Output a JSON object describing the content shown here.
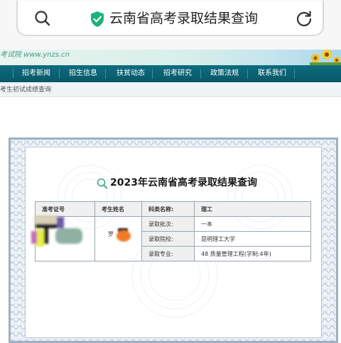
{
  "browser": {
    "url_title": "云南省高考录取结果查询",
    "icons": {
      "search": "search-icon",
      "secure": "shield-check-icon",
      "reload": "reload-icon"
    }
  },
  "site": {
    "banner_text": "考试院 www.ynzs.cn",
    "nav": [
      {
        "label": "招考新闻"
      },
      {
        "label": "招生信息"
      },
      {
        "label": "扶贫动态"
      },
      {
        "label": "招考研究"
      },
      {
        "label": "政策法规"
      },
      {
        "label": "联系我们"
      }
    ],
    "sub_link": "考生初试成绩查询"
  },
  "result": {
    "title": "2023年云南省高考录取结果查询",
    "headers": {
      "exam_no": "准考证号",
      "name": "考生姓名",
      "subject_type": "科类名称:",
      "subject_value": "理工"
    },
    "name_prefix": "罗",
    "rows": [
      {
        "label": "录取批次:",
        "value": "一本"
      },
      {
        "label": "录取院校:",
        "value": "昆明理工大学"
      },
      {
        "label": "录取专业:",
        "value": "48 质量管理工程(学制:4年)"
      }
    ]
  },
  "colors": {
    "nav_bg": "#0e6d80",
    "secure_green": "#1bb37a",
    "certificate_border": "#9eb1c4"
  }
}
